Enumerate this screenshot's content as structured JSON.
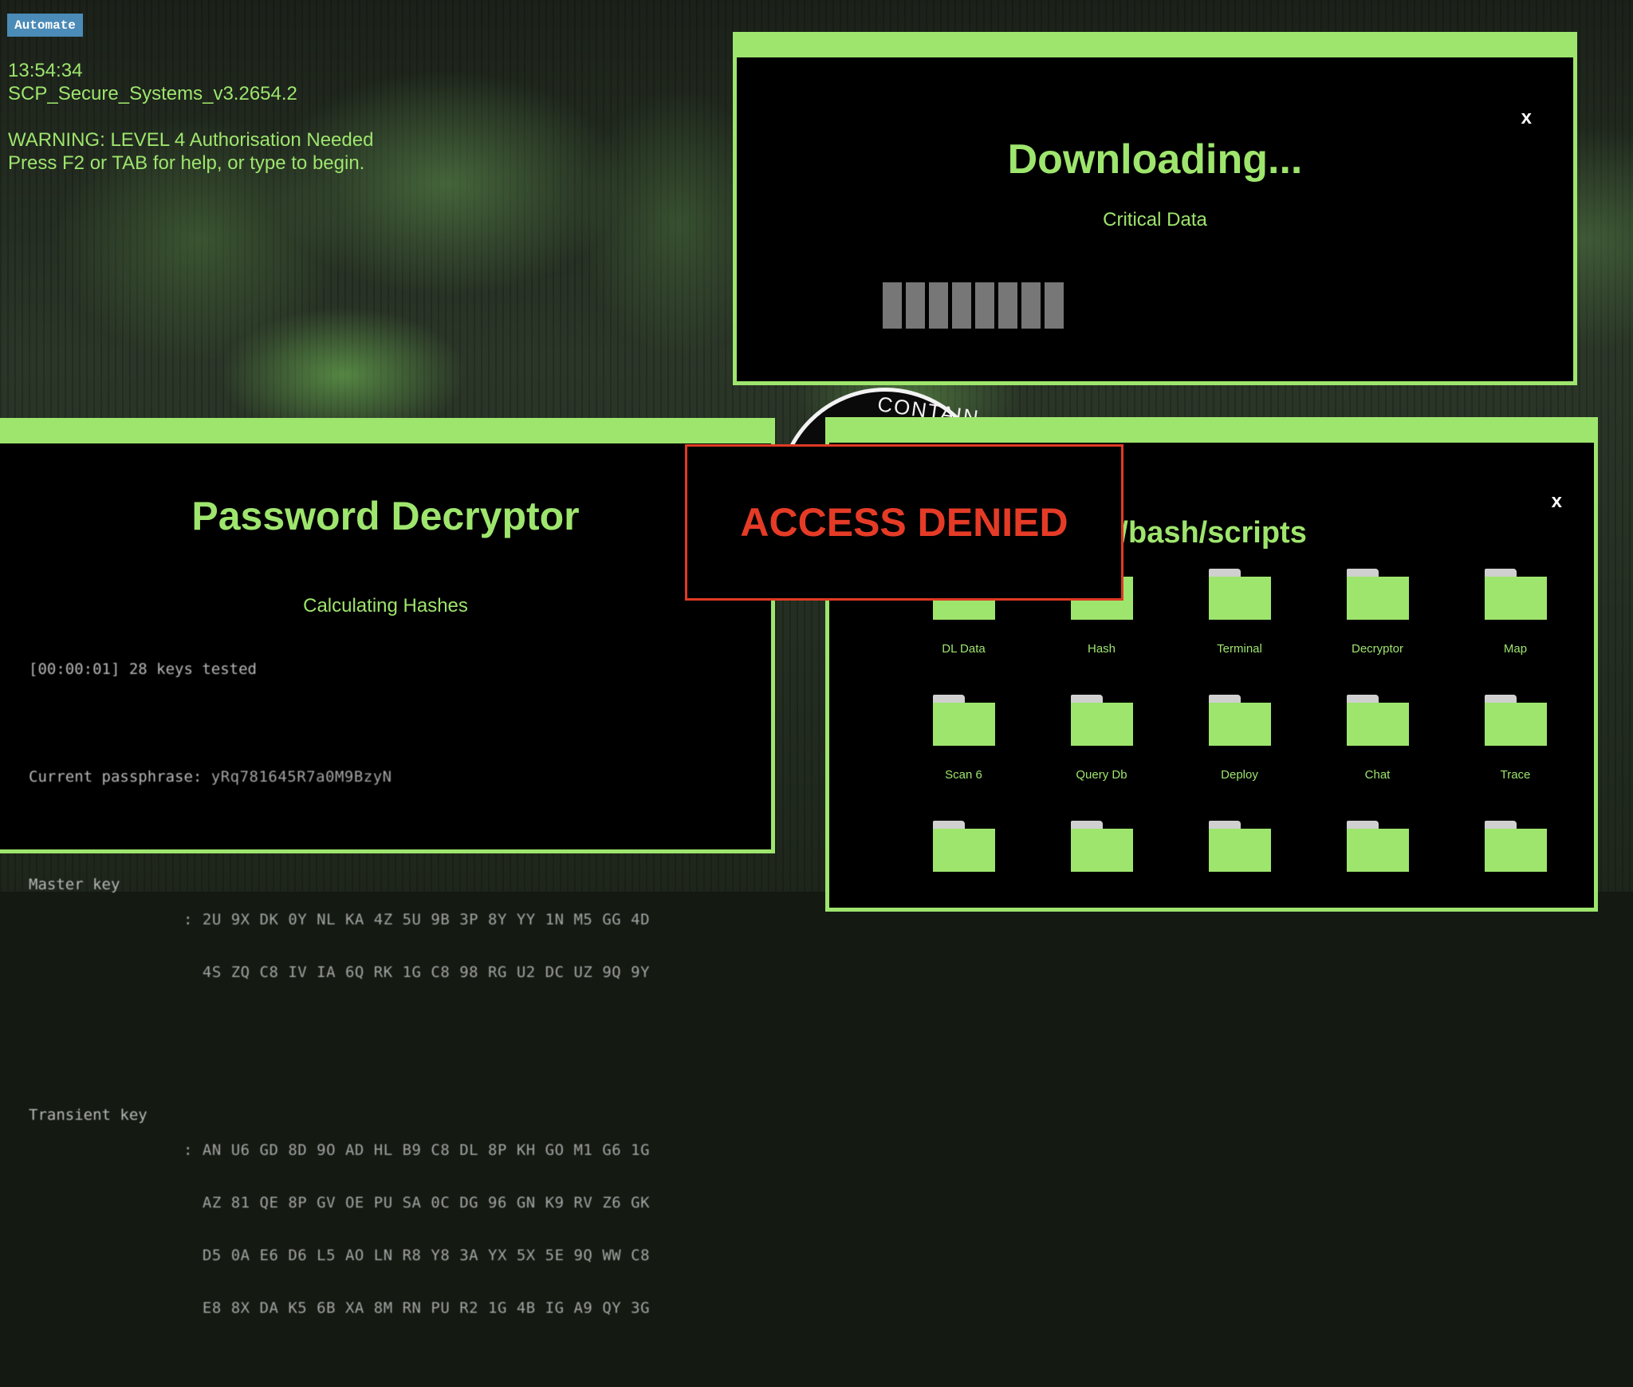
{
  "toolbar": {
    "automate_label": "Automate"
  },
  "status": {
    "time": "13:54:34",
    "system": "SCP_Secure_Systems_v3.2654.2",
    "warning": "WARNING: LEVEL 4 Authorisation Needed",
    "hint": "Press F2 or TAB for help, or type to begin."
  },
  "emblem": {
    "text": "CONTAIN"
  },
  "download_window": {
    "title": "Downloading...",
    "subtitle": "Critical Data",
    "close_label": "x",
    "progress": {
      "filled_blocks": 8
    }
  },
  "decryptor_window": {
    "title": "Password Decryptor",
    "subtitle": "Calculating Hashes",
    "log": "[00:00:01] 28 keys tested",
    "passphrase_label": "Current passphrase: ",
    "passphrase": "yRq781645R7a0M9BzyN",
    "master_key_label": "Master key",
    "master_key_lines": [
      ": 2U 9X DK 0Y NL KA 4Z 5U 9B 3P 8Y YY 1N M5 GG 4D",
      "  4S ZQ C8 IV IA 6Q RK 1G C8 98 RG U2 DC UZ 9Q 9Y"
    ],
    "transient_key_label": "Transient key",
    "transient_key_lines": [
      ": AN U6 GD 8D 9O AD HL B9 C8 DL 8P KH GO M1 G6 1G",
      "  AZ 81 QE 8P GV OE PU SA 0C DG 96 GN K9 RV Z6 GK",
      "  D5 0A E6 D6 L5 AO LN R8 Y8 3A YX 5X 5E 9Q WW C8",
      "  E8 8X DA K5 6B XA 8M RN PU R2 1G 4B IG A9 QY 3G"
    ]
  },
  "file_window": {
    "title": "/root/bash/scripts",
    "close_label": "x",
    "folders": [
      {
        "label": "DL Data"
      },
      {
        "label": "Hash"
      },
      {
        "label": "Terminal"
      },
      {
        "label": "Decryptor"
      },
      {
        "label": "Map"
      },
      {
        "label": "Scan 6"
      },
      {
        "label": "Query Db"
      },
      {
        "label": "Deploy"
      },
      {
        "label": "Chat"
      },
      {
        "label": "Trace"
      },
      {
        "label": ""
      },
      {
        "label": ""
      },
      {
        "label": ""
      },
      {
        "label": ""
      },
      {
        "label": ""
      }
    ]
  },
  "alert": {
    "text": "ACCESS DENIED"
  },
  "colors": {
    "accent": "#9ee56d",
    "alert": "#e53b26",
    "button": "#4b8bb8",
    "progress_block": "#777777"
  }
}
